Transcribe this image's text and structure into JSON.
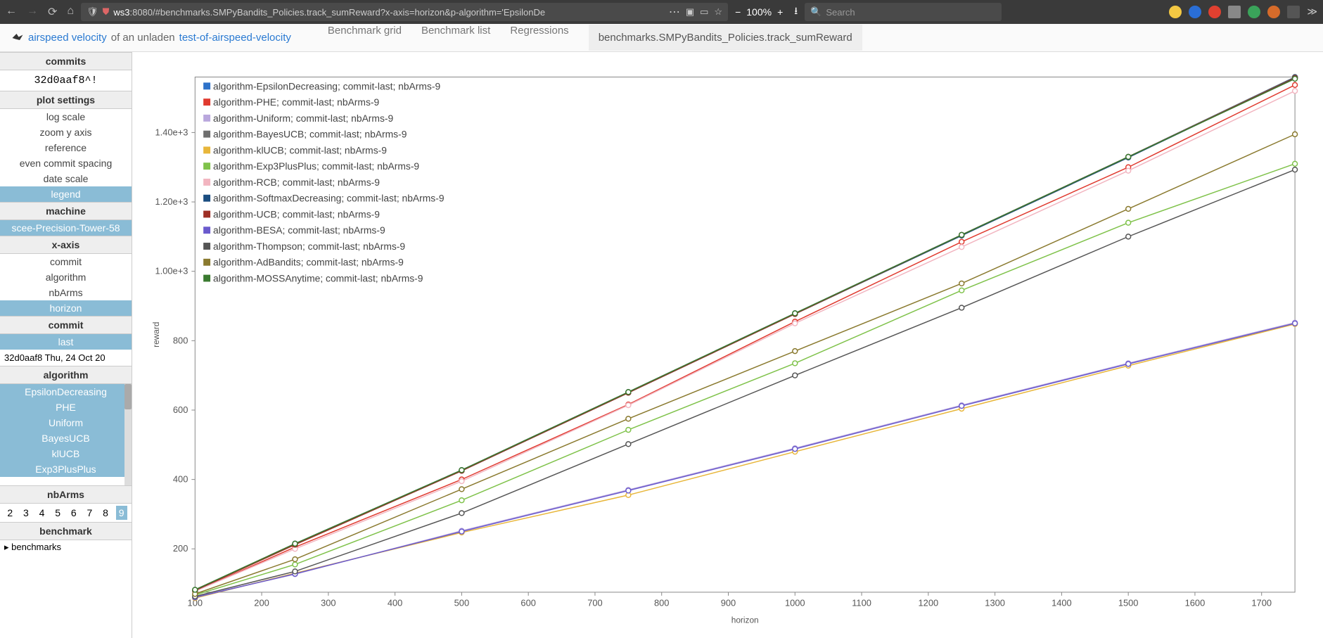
{
  "browser": {
    "url_pre": "ws3",
    "url_port": ":8080/#benchmarks.SMPyBandits_Policies.track_sumReward?x-axis=horizon&p-algorithm='EpsilonDe",
    "zoom": "100%",
    "search_placeholder": "Search"
  },
  "topnav": {
    "brand_a": "airspeed velocity",
    "brand_mid": " of an unladen ",
    "brand_b": "test-of-airspeed-velocity",
    "links": [
      "Benchmark grid",
      "Benchmark list",
      "Regressions"
    ],
    "active": "benchmarks.SMPyBandits_Policies.track_sumReward"
  },
  "sidebar": {
    "commits_head": "commits",
    "commit_hash": "32d0aaf8^!",
    "plot_head": "plot settings",
    "plot_opts": [
      "log scale",
      "zoom y axis",
      "reference",
      "even commit spacing",
      "date scale",
      "legend"
    ],
    "plot_selected_index": 5,
    "machine_head": "machine",
    "machine_opt": "scee-Precision-Tower-58",
    "xaxis_head": "x-axis",
    "xaxis_opts": [
      "commit",
      "algorithm",
      "nbArms",
      "horizon"
    ],
    "xaxis_selected_index": 3,
    "commit_head": "commit",
    "commit_last": "last",
    "commit_line": "32d0aaf8 Thu, 24 Oct 20",
    "algorithm_head": "algorithm",
    "algorithms": [
      "EpsilonDecreasing",
      "PHE",
      "Uniform",
      "BayesUCB",
      "klUCB",
      "Exp3PlusPlus"
    ],
    "nbarms_head": "nbArms",
    "nbarms": [
      "2",
      "3",
      "4",
      "5",
      "6",
      "7",
      "8",
      "9"
    ],
    "nbarms_selected_index": 7,
    "benchmark_head": "benchmark",
    "benchmark_item": "benchmarks"
  },
  "chart_data": {
    "type": "line",
    "xlabel": "horizon",
    "ylabel": "reward",
    "x": [
      100,
      250,
      500,
      750,
      1000,
      1250,
      1500,
      1750
    ],
    "xlim": [
      100,
      1750
    ],
    "ylim": [
      75,
      1560
    ],
    "yticks": [
      200,
      400,
      600,
      800,
      "1.00e+3",
      "1.20e+3",
      "1.40e+3"
    ],
    "ytick_vals": [
      200,
      400,
      600,
      800,
      1000,
      1200,
      1400
    ],
    "xticks": [
      100,
      200,
      300,
      400,
      500,
      600,
      700,
      800,
      900,
      1000,
      1100,
      1200,
      1300,
      1400,
      1500,
      1600,
      1700
    ],
    "series": [
      {
        "name": "algorithm-EpsilonDecreasing; commit-last; nbArms-9",
        "color": "#2e72c9",
        "values": [
          80,
          215,
          427,
          652,
          879,
          1105,
          1330,
          1560
        ]
      },
      {
        "name": "algorithm-PHE; commit-last; nbArms-9",
        "color": "#e03a2f",
        "values": [
          78,
          205,
          400,
          616,
          855,
          1085,
          1300,
          1537
        ]
      },
      {
        "name": "algorithm-Uniform; commit-last; nbArms-9",
        "color": "#b9a7dd",
        "values": [
          62,
          127,
          252,
          370,
          490,
          614,
          735,
          852
        ]
      },
      {
        "name": "algorithm-BayesUCB; commit-last; nbArms-9",
        "color": "#6f6f6f",
        "values": [
          82,
          215,
          427,
          652,
          879,
          1105,
          1330,
          1560
        ]
      },
      {
        "name": "algorithm-klUCB; commit-last; nbArms-9",
        "color": "#e8b63a",
        "values": [
          58,
          130,
          247,
          355,
          480,
          604,
          728,
          848
        ]
      },
      {
        "name": "algorithm-Exp3PlusPlus; commit-last; nbArms-9",
        "color": "#7fc24a",
        "values": [
          67,
          155,
          340,
          543,
          735,
          945,
          1140,
          1310
        ]
      },
      {
        "name": "algorithm-RCB; commit-last; nbArms-9",
        "color": "#f2b5c0",
        "values": [
          78,
          200,
          395,
          614,
          850,
          1070,
          1290,
          1520
        ]
      },
      {
        "name": "algorithm-SoftmaxDecreasing; commit-last; nbArms-9",
        "color": "#1a4d80",
        "values": [
          80,
          213,
          425,
          650,
          877,
          1103,
          1328,
          1558
        ]
      },
      {
        "name": "algorithm-UCB; commit-last; nbArms-9",
        "color": "#9e2f25",
        "values": [
          80,
          212,
          425,
          650,
          877,
          1105,
          1330,
          1557
        ]
      },
      {
        "name": "algorithm-BESA; commit-last; nbArms-9",
        "color": "#6a5acd",
        "values": [
          60,
          128,
          250,
          368,
          488,
          612,
          733,
          850
        ]
      },
      {
        "name": "algorithm-Thompson; commit-last; nbArms-9",
        "color": "#555555",
        "values": [
          63,
          135,
          303,
          502,
          700,
          895,
          1100,
          1293
        ]
      },
      {
        "name": "algorithm-AdBandits; commit-last; nbArms-9",
        "color": "#8a7a2f",
        "values": [
          70,
          170,
          372,
          575,
          770,
          965,
          1180,
          1395
        ]
      },
      {
        "name": "algorithm-MOSSAnytime; commit-last; nbArms-9",
        "color": "#3a7a2f",
        "values": [
          82,
          215,
          427,
          652,
          879,
          1105,
          1330,
          1555
        ]
      }
    ]
  }
}
